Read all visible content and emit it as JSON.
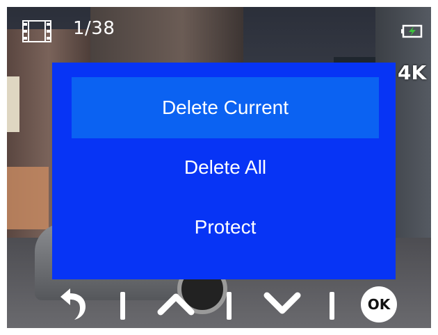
{
  "status_bar": {
    "mode_icon": "film-strip-icon",
    "file_counter": "1/38",
    "battery_icon": "battery-charging-icon",
    "battery_color": "#3cc43c",
    "resolution": "4K"
  },
  "menu": {
    "background_color": "#0734f5",
    "selected_color": "#0b62f2",
    "items": [
      {
        "label": "Delete Current",
        "selected": true
      },
      {
        "label": "Delete All",
        "selected": false
      },
      {
        "label": "Protect",
        "selected": false
      }
    ]
  },
  "buttons": {
    "back_icon": "back-arrow-icon",
    "up_icon": "chevron-up-icon",
    "down_icon": "chevron-down-icon",
    "ok_label": "OK"
  }
}
